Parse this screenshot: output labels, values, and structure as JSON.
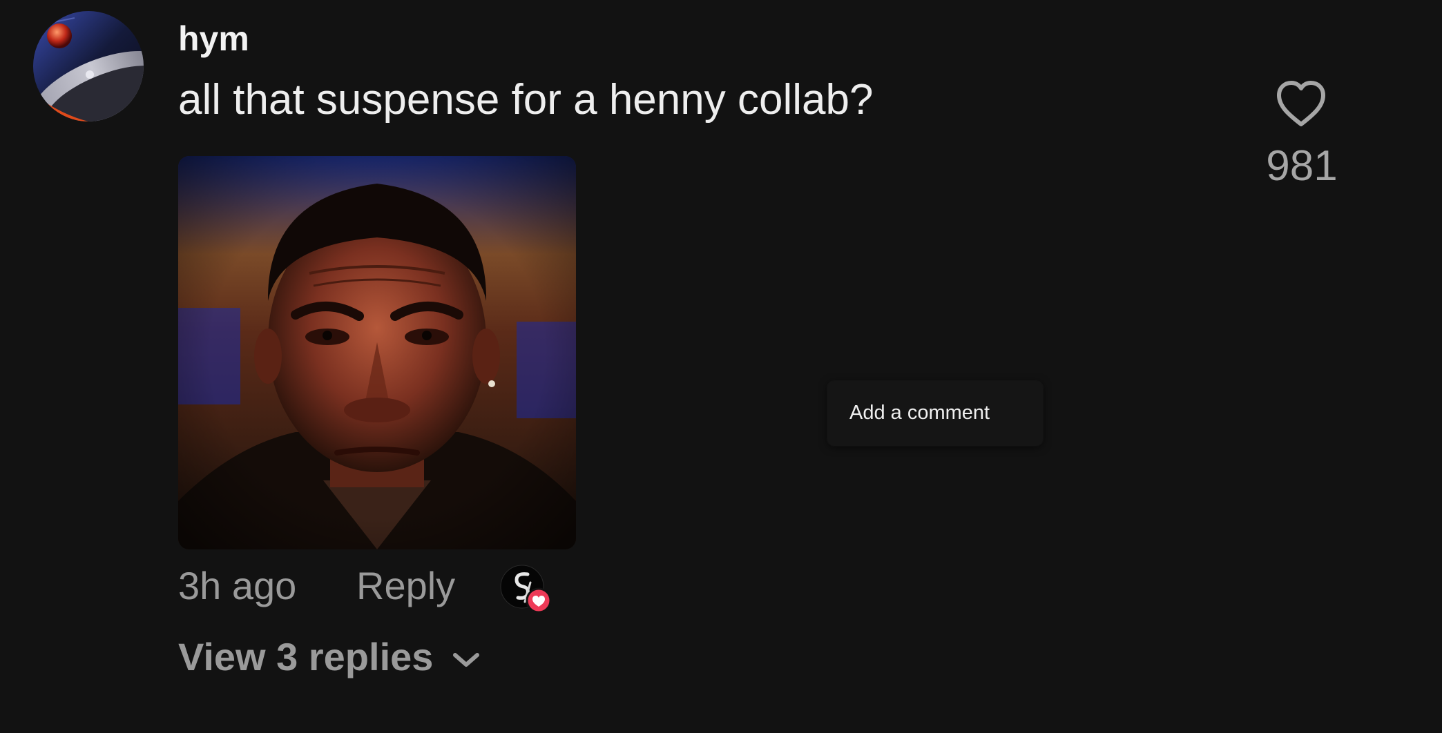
{
  "comment": {
    "username": "hym",
    "text": "all that suspense for a henny collab?",
    "like_count": "981",
    "timestamp": "3h ago",
    "reply_label": "Reply",
    "view_replies_label": "View 3 replies"
  },
  "popup": {
    "add_comment_label": "Add a comment"
  },
  "icons": {
    "like": "heart-outline-icon",
    "creator_liked": "creator-liked-badge",
    "expand": "chevron-down-icon"
  },
  "colors": {
    "background": "#121212",
    "primary_text": "#eeeeee",
    "secondary_text": "#9a9a9a",
    "heart_badge": "#ee3a57"
  }
}
